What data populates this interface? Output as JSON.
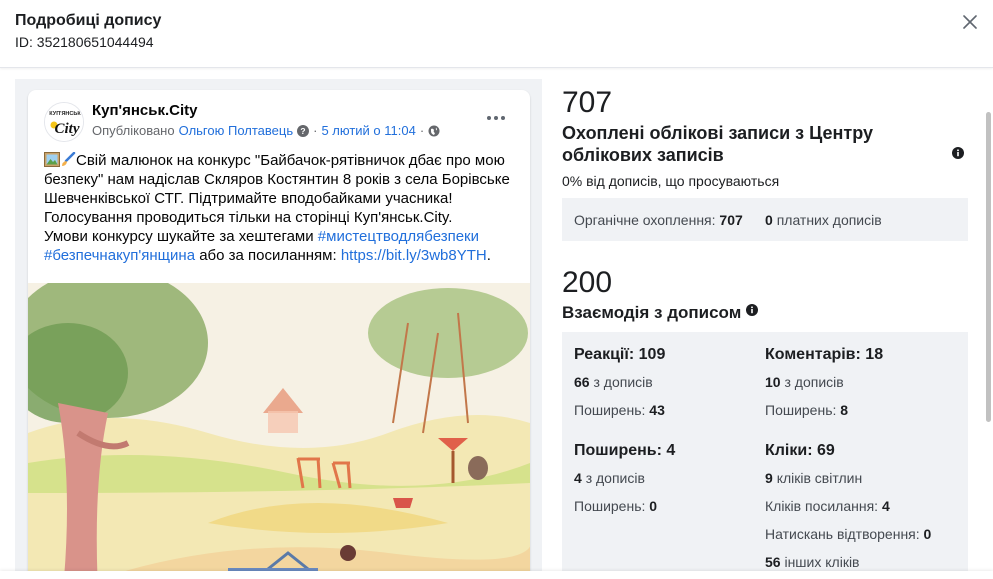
{
  "dialog": {
    "title": "Подробиці допису",
    "id_label": "ID: 352180651044494"
  },
  "post": {
    "page_name": "Куп'янськ.City",
    "avatar_text_top": "КУП'ЯНСЬК",
    "avatar_text_main": "City",
    "published_label": "Опубліковано",
    "author": "Ольгою Полтавець",
    "dot": "·",
    "date": "5 лютий о 11:04",
    "text_line1": "Свій малюнок на конкурс \"Байбачок-рятівничок дбає про мою безпеку\" нам надіслав Скляров Костянтин 8 років з села Борівське Шевченківської СТГ. Підтримайте вподобайками учасника! Голосування проводиться тільки на сторінці Куп'янськ.City.",
    "text_line2_prefix": "Умови конкурсу шукайте за хештегами ",
    "hashtag1": "#мистецтводлябезпеки",
    "hashtag2": "#безпечнакуп'янщина",
    "text_line2_mid": " або за посиланням: ",
    "link": "https://bit.ly/3wb8YTH",
    "text_end": "."
  },
  "reach": {
    "value": "707",
    "title": "Охоплені облікові записи з Центру облікових записів",
    "promoted": "0% від дописів, що просуваються",
    "organic_label": "Органічне охоплення:",
    "organic_value": "707",
    "paid_value": "0",
    "paid_label": "платних дописів"
  },
  "engagement": {
    "value": "200",
    "title": "Взаємодія з дописом",
    "reactions_label": "Реакції:",
    "reactions_value": "109",
    "reactions_from_posts_value": "66",
    "reactions_from_posts_label": "з дописів",
    "reactions_shares_label": "Поширень:",
    "reactions_shares_value": "43",
    "comments_label": "Коментарів:",
    "comments_value": "18",
    "comments_from_posts_value": "10",
    "comments_from_posts_label": "з дописів",
    "comments_shares_label": "Поширень:",
    "comments_shares_value": "8",
    "shares_label": "Поширень:",
    "shares_value": "4",
    "shares_from_posts_value": "4",
    "shares_from_posts_label": "з дописів",
    "shares_shares_label": "Поширень:",
    "shares_shares_value": "0",
    "clicks_label": "Кліки:",
    "clicks_value": "69",
    "photo_clicks_value": "9",
    "photo_clicks_label": "кліків світлин",
    "link_clicks_label": "Кліків посилання:",
    "link_clicks_value": "4",
    "play_clicks_label": "Натискань відтворення:",
    "play_clicks_value": "0",
    "other_clicks_value": "56",
    "other_clicks_label": "інших кліків"
  }
}
